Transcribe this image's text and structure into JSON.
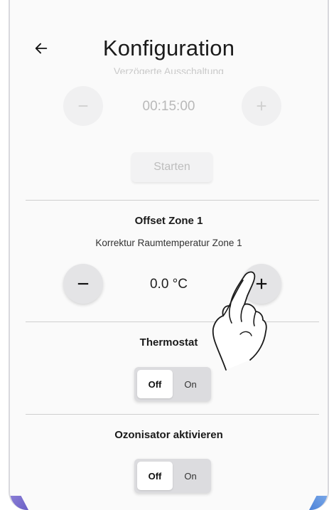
{
  "appbar": {
    "title": "Konfiguration",
    "back_icon": "arrow-left-icon"
  },
  "delayed_section": {
    "faded_label": "Verzögerte Ausschaltung",
    "value": "00:15:00",
    "minus_icon": "minus-icon",
    "plus_icon": "plus-icon",
    "start_label": "Starten"
  },
  "offset_section": {
    "title": "Offset Zone 1",
    "subtitle": "Korrektur Raumtemperatur Zone 1",
    "value": "0.0 °C",
    "minus_icon": "minus-icon",
    "plus_icon": "plus-icon"
  },
  "thermostat_section": {
    "title": "Thermostat",
    "off_label": "Off",
    "on_label": "On",
    "selected": "Off"
  },
  "ozonizer_section": {
    "title": "Ozonisator aktivieren",
    "off_label": "Off",
    "on_label": "On",
    "selected": "Off"
  },
  "overlay": {
    "gesture_icon": "tap-hand-icon"
  },
  "colors": {
    "background": "#fafafa",
    "button_gray": "#e4e4e6",
    "disabled_text": "#b9b9b9",
    "toggle_track": "#dcdcdf"
  }
}
